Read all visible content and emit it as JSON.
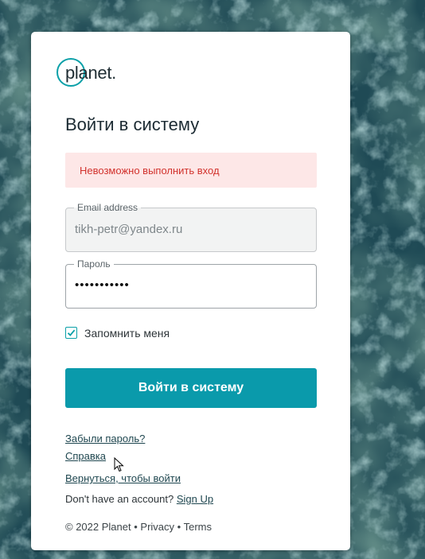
{
  "logo": {
    "text": "planet."
  },
  "login": {
    "title": "Войти в систему",
    "error_message": "Невозможно выполнить вход",
    "email": {
      "label": "Email address",
      "value": "tikh-petr@yandex.ru"
    },
    "password": {
      "label": "Пароль",
      "value": "•••••••••••"
    },
    "remember": {
      "label": "Запомнить меня",
      "checked": true
    },
    "submit_label": "Войти в систему"
  },
  "links": {
    "forgot_password": "Забыли пароль?",
    "help": "Справка",
    "back_to_login": "Вернуться, чтобы войти",
    "no_account_text": "Don't have an account?",
    "sign_up": "Sign Up"
  },
  "footer": {
    "copyright": "© 2022 Planet",
    "separator": "•",
    "privacy": "Privacy",
    "terms": "Terms"
  },
  "colors": {
    "accent": "#0a9aab",
    "error_bg": "#fde7e7",
    "error_text": "#d2322d"
  }
}
